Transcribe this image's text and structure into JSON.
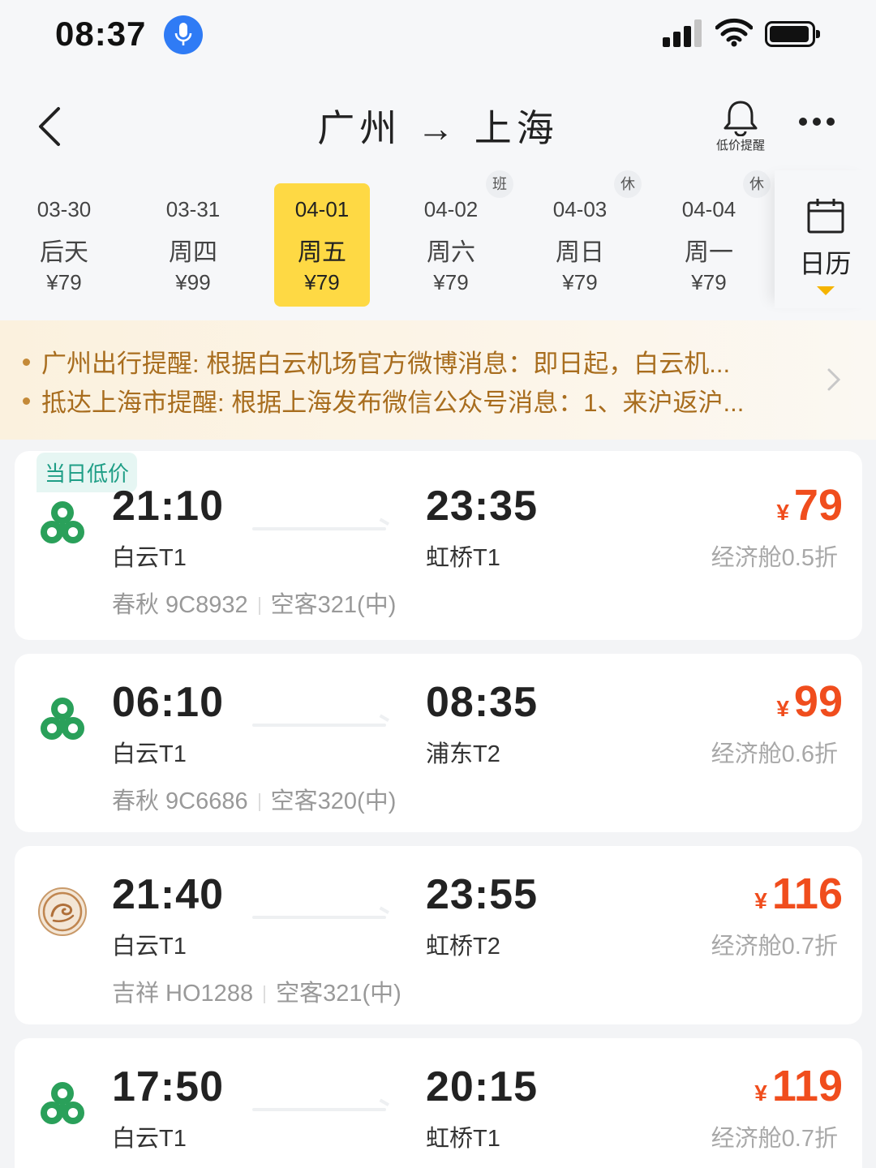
{
  "status_bar": {
    "time": "08:37"
  },
  "header": {
    "title": "广州 → 上海",
    "alert_label": "低价提醒"
  },
  "dates": [
    {
      "date": "03-30",
      "weekday": "后天",
      "price": "¥79",
      "tag": ""
    },
    {
      "date": "03-31",
      "weekday": "周四",
      "price": "¥99",
      "tag": ""
    },
    {
      "date": "04-01",
      "weekday": "周五",
      "price": "¥79",
      "tag": "",
      "selected": true
    },
    {
      "date": "04-02",
      "weekday": "周六",
      "price": "¥79",
      "tag": "班"
    },
    {
      "date": "04-03",
      "weekday": "周日",
      "price": "¥79",
      "tag": "休"
    },
    {
      "date": "04-04",
      "weekday": "周一",
      "price": "¥79",
      "tag": "休"
    }
  ],
  "calendar_label": "日历",
  "notices": [
    "广州出行提醒: 根据白云机场官方微博消息：即日起，白云机...",
    "抵达上海市提醒: 根据上海发布微信公众号消息：1、来沪返沪..."
  ],
  "flights": [
    {
      "badge": "当日低价",
      "logo": "spring-airlines-logo",
      "dep_time": "21:10",
      "dep_airport": "白云T1",
      "arr_time": "23:35",
      "arr_airport": "虹桥T1",
      "airline_flight": "春秋 9C8932",
      "aircraft": "空客321(中)",
      "currency": "¥",
      "price": "79",
      "cabin": "经济舱0.5折"
    },
    {
      "badge": "",
      "logo": "spring-airlines-logo",
      "dep_time": "06:10",
      "dep_airport": "白云T1",
      "arr_time": "08:35",
      "arr_airport": "浦东T2",
      "airline_flight": "春秋 9C6686",
      "aircraft": "空客320(中)",
      "currency": "¥",
      "price": "99",
      "cabin": "经济舱0.6折"
    },
    {
      "badge": "",
      "logo": "juneyao-airlines-logo",
      "dep_time": "21:40",
      "dep_airport": "白云T1",
      "arr_time": "23:55",
      "arr_airport": "虹桥T2",
      "airline_flight": "吉祥 HO1288",
      "aircraft": "空客321(中)",
      "currency": "¥",
      "price": "116",
      "cabin": "经济舱0.7折"
    },
    {
      "badge": "",
      "logo": "spring-airlines-logo",
      "dep_time": "17:50",
      "dep_airport": "白云T1",
      "arr_time": "20:15",
      "arr_airport": "虹桥T1",
      "airline_flight": "",
      "aircraft": "",
      "currency": "¥",
      "price": "119",
      "cabin": "经济舱0.7折"
    }
  ],
  "colors": {
    "accent_yellow": "#fed944",
    "price_red": "#f04d1d",
    "badge_green": "#1f9e86",
    "notice_text": "#a86d1e"
  }
}
